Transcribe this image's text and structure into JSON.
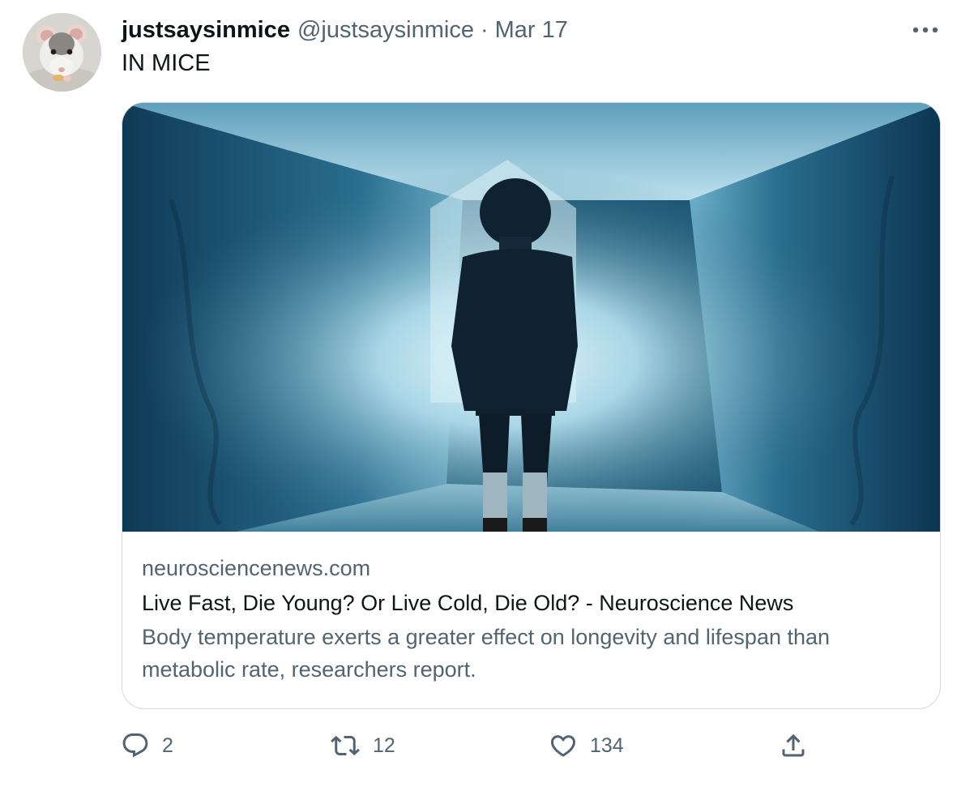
{
  "tweet": {
    "display_name": "justsaysinmice",
    "handle": "@justsaysinmice",
    "separator": "·",
    "date": "Mar 17",
    "text": "IN MICE",
    "avatar_icon": "mouse-avatar"
  },
  "card": {
    "domain": "neurosciencenews.com",
    "title": "Live Fast, Die Young? Or Live Cold, Die Old? - Neuroscience News",
    "description": "Body temperature exerts a greater effect on longevity and lifespan than metabolic rate, researchers report.",
    "image_icon": "ice-tunnel-photo"
  },
  "actions": {
    "reply": {
      "icon": "reply-icon",
      "count": "2"
    },
    "retweet": {
      "icon": "retweet-icon",
      "count": "12"
    },
    "like": {
      "icon": "heart-icon",
      "count": "134"
    },
    "share": {
      "icon": "share-icon"
    }
  },
  "colors": {
    "text_primary": "#0f1419",
    "text_secondary": "#536471",
    "border": "#cfd9de"
  }
}
